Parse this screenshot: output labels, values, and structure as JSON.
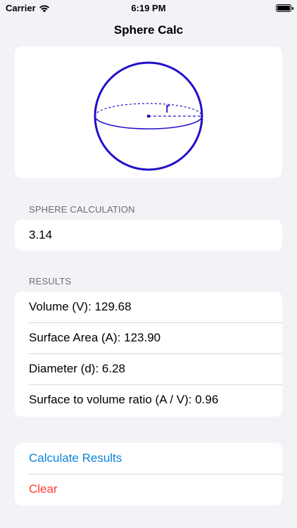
{
  "status_bar": {
    "carrier": "Carrier",
    "time": "6:19 PM"
  },
  "nav": {
    "title": "Sphere Calc"
  },
  "illustration": {
    "radius_label": "r",
    "stroke_color": "#1f0fc9"
  },
  "input_section": {
    "header": "SPHERE CALCULATION",
    "value": "3.14"
  },
  "results": {
    "header": "RESULTS",
    "items": [
      "Volume (V): 129.68",
      "Surface Area (A): 123.90",
      "Diameter (d): 6.28",
      "Surface to volume ratio (A / V): 0.96"
    ]
  },
  "actions": {
    "calculate": "Calculate Results",
    "clear": "Clear"
  },
  "colors": {
    "background": "#f2f2f7",
    "link": "#0a84d8",
    "destructive": "#ff3b30"
  }
}
